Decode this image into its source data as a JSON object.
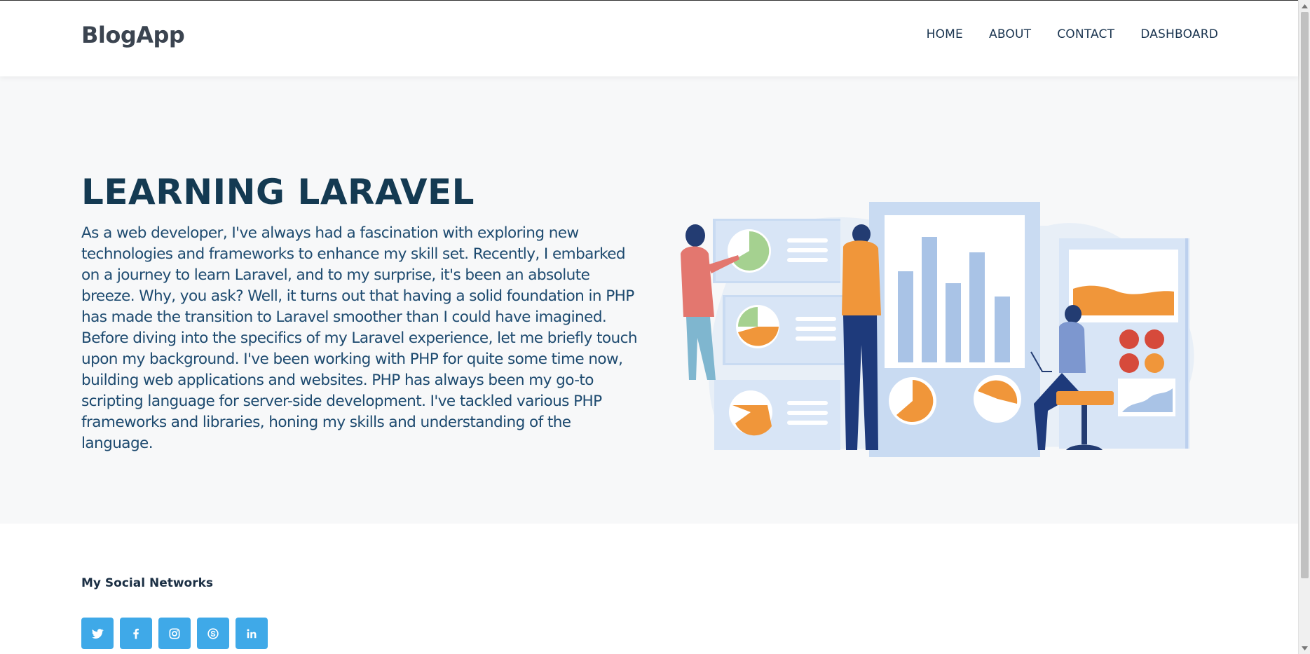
{
  "navbar": {
    "brand": "BlogApp",
    "links": [
      "HOME",
      "ABOUT",
      "CONTACT",
      "DASHBOARD"
    ]
  },
  "hero": {
    "title": "LEARNING LARAVEL",
    "text": "As a web developer, I've always had a fascination with exploring new technologies and frameworks to enhance my skill set. Recently, I embarked on a journey to learn Laravel, and to my surprise, it's been an absolute breeze. Why, you ask? Well, it turns out that having a solid foundation in PHP has made the transition to Laravel smoother than I could have imagined. Before diving into the specifics of my Laravel experience, let me briefly touch upon my background. I've been working with PHP for quite some time now, building web applications and websites. PHP has always been my go-to scripting language for server-side development. I've tackled various PHP frameworks and libraries, honing my skills and understanding of the language."
  },
  "footer": {
    "social_title": "My Social Networks",
    "social_icons": [
      "twitter-icon",
      "facebook-icon",
      "instagram-icon",
      "skype-icon",
      "linkedin-icon"
    ]
  },
  "colors": {
    "accent": "#3fa9e8",
    "title": "#143a52",
    "text": "#1d4a6f",
    "hero_bg": "#f7f8f9",
    "illustration_orange": "#f0963a",
    "illustration_blue": "#cfe0f3"
  }
}
